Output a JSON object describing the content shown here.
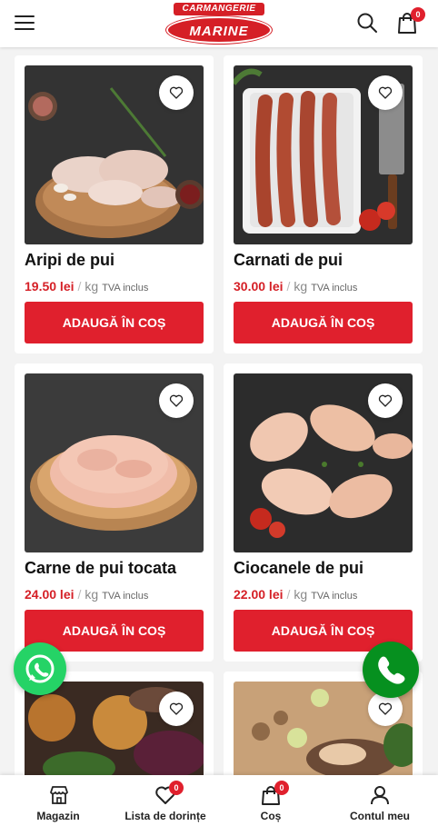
{
  "header": {
    "logo_top": "CARMANGERIE",
    "logo_main": "MARINE",
    "cart_count": "0"
  },
  "products": [
    {
      "title": "Aripi de pui",
      "price": "19.50 lei",
      "unit": "kg",
      "vat": "TVA inclus",
      "button": "ADAUGĂ ÎN COȘ"
    },
    {
      "title": "Carnati de pui",
      "price": "30.00 lei",
      "unit": "kg",
      "vat": "TVA inclus",
      "button": "ADAUGĂ ÎN COȘ"
    },
    {
      "title": "Carne de pui tocata",
      "price": "24.00 lei",
      "unit": "kg",
      "vat": "TVA inclus",
      "button": "ADAUGĂ ÎN COȘ"
    },
    {
      "title": "Ciocanele de pui",
      "price": "22.00 lei",
      "unit": "kg",
      "vat": "TVA inclus",
      "button": "ADAUGĂ ÎN COȘ"
    }
  ],
  "bottom_nav": {
    "shop": "Magazin",
    "wishlist": "Lista de dorințe",
    "wishlist_count": "0",
    "cart": "Coș",
    "cart_count": "0",
    "account": "Contul meu"
  },
  "colors": {
    "accent": "#e0202d",
    "whatsapp": "#25d366",
    "call": "#06901f"
  }
}
